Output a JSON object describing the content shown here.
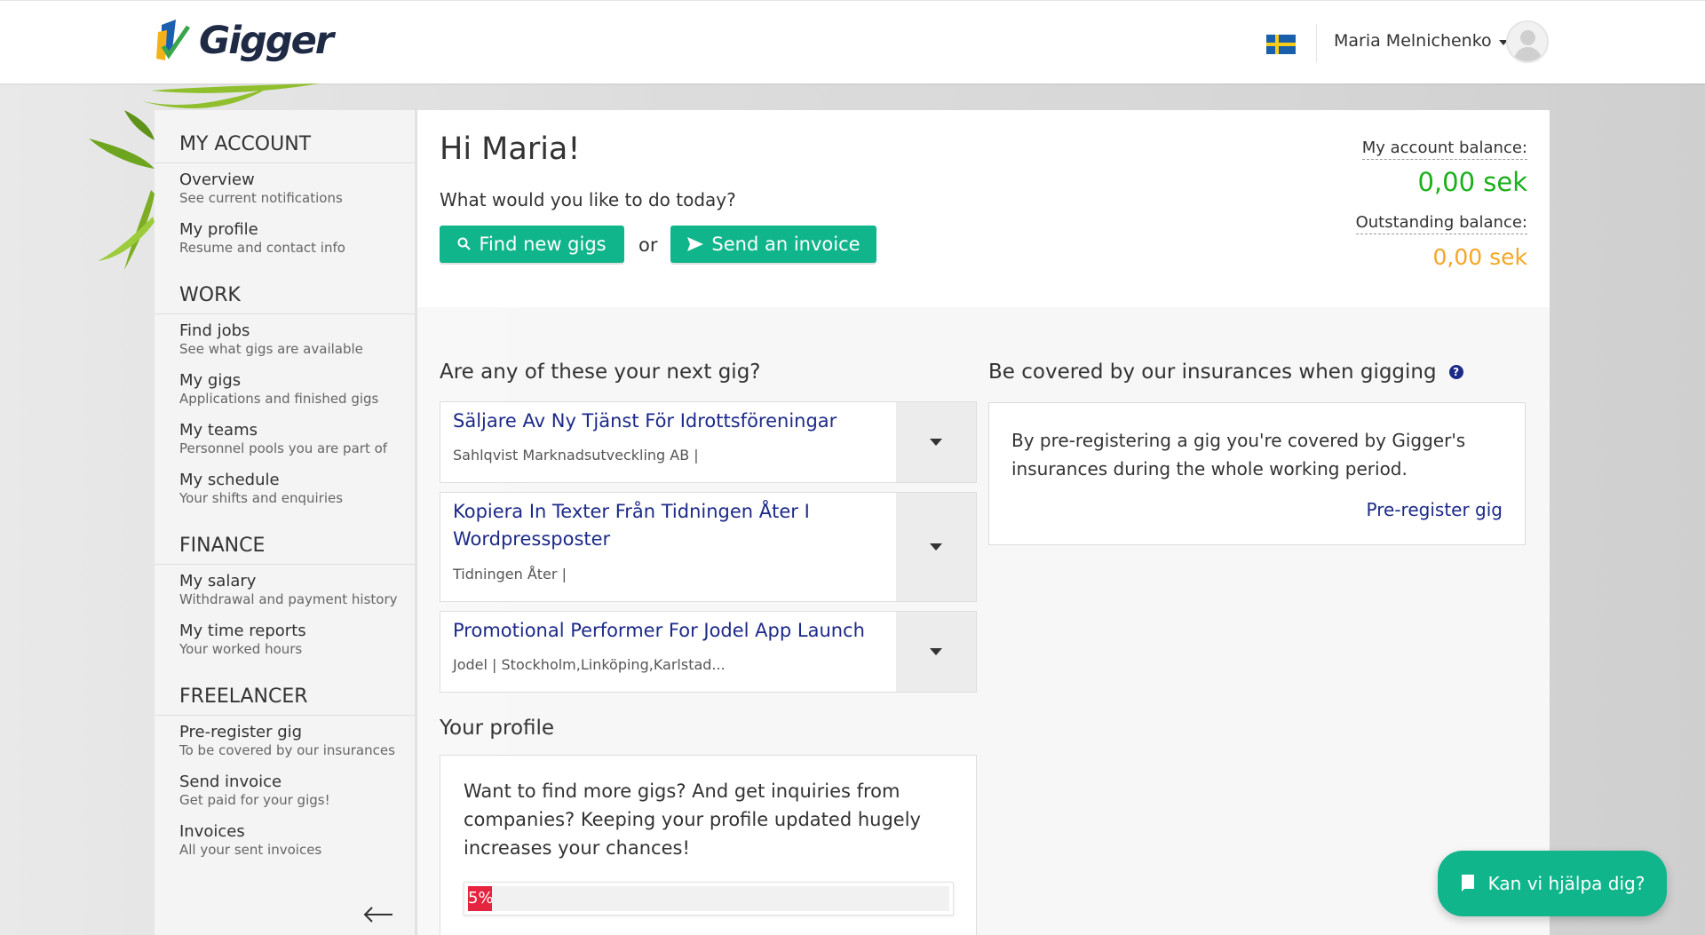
{
  "brand": {
    "name": "Gigger"
  },
  "header": {
    "user_name": "Maria Melnichenko",
    "flag": "sweden-flag-icon"
  },
  "sidebar": {
    "sections": [
      {
        "title": "MY ACCOUNT",
        "items": [
          {
            "label": "Overview",
            "sub": "See current notifications"
          },
          {
            "label": "My profile",
            "sub": "Resume and contact info"
          }
        ]
      },
      {
        "title": "WORK",
        "items": [
          {
            "label": "Find jobs",
            "sub": "See what gigs are available"
          },
          {
            "label": "My gigs",
            "sub": "Applications and finished gigs"
          },
          {
            "label": "My teams",
            "sub": "Personnel pools you are part of"
          },
          {
            "label": "My schedule",
            "sub": "Your shifts and enquiries"
          }
        ]
      },
      {
        "title": "FINANCE",
        "items": [
          {
            "label": "My salary",
            "sub": "Withdrawal and payment history"
          },
          {
            "label": "My time reports",
            "sub": "Your worked hours"
          }
        ]
      },
      {
        "title": "FREELANCER",
        "items": [
          {
            "label": "Pre-register gig",
            "sub": "To be covered by our insurances"
          },
          {
            "label": "Send invoice",
            "sub": "Get paid for your gigs!"
          },
          {
            "label": "Invoices",
            "sub": "All your sent invoices"
          }
        ]
      }
    ]
  },
  "welcome": {
    "greeting": "Hi Maria!",
    "question": "What would you like to do today?",
    "find_label": "Find new gigs",
    "or_label": "or",
    "send_label": "Send an invoice",
    "account_balance_label": "My account balance:",
    "account_balance_value": "0,00 sek",
    "outstanding_label": "Outstanding balance:",
    "outstanding_value": "0,00 sek"
  },
  "gigs": {
    "title": "Are any of these your next gig?",
    "items": [
      {
        "title": "Säljare Av Ny Tjänst För Idrottsföreningar",
        "company": "Sahlqvist Marknadsutveckling AB |"
      },
      {
        "title": "Kopiera In Texter Från Tidningen Åter I Wordpressposter",
        "company": "Tidningen Åter |"
      },
      {
        "title": "Promotional Performer For Jodel App Launch",
        "company": "Jodel | Stockholm,Linköping,Karlstad..."
      }
    ]
  },
  "insurance": {
    "title": "Be covered by our insurances when gigging",
    "help": "?",
    "text": "By pre-registering a gig you're covered by Gigger's insurances during the whole working period.",
    "link": "Pre-register gig"
  },
  "profile": {
    "title": "Your profile",
    "text": "Want to find more gigs? And get inquiries from companies? Keeping your profile updated hugely increases your chances!",
    "progress_percent": 5,
    "progress_label": "5%"
  },
  "chat": {
    "label": "Kan vi hjälpa dig?"
  },
  "colors": {
    "green": "#11b58c",
    "navy": "#1c2a88",
    "balance_green": "#19b01a",
    "balance_orange": "#f5a623",
    "progress_red": "#e52540"
  }
}
